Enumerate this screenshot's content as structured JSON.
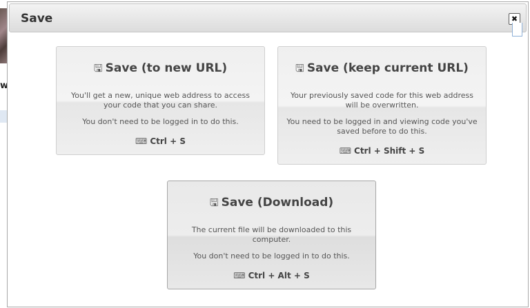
{
  "dialog": {
    "title": "Save",
    "close_label": "✖"
  },
  "background": {
    "letter": "w"
  },
  "options": [
    {
      "icon": "floppy-disk-icon",
      "title": "Save (to new URL)",
      "description": "You'll get a new, unique web address to access your code that you can share.",
      "note": "You don't need to be logged in to do this.",
      "shortcut_icon": "keyboard-icon",
      "shortcut": "Ctrl + S"
    },
    {
      "icon": "floppy-disk-icon",
      "title": "Save (keep current URL)",
      "description": "Your previously saved code for this web address will be overwritten.",
      "note": "You need to be logged in and viewing code you've saved before to do this.",
      "shortcut_icon": "keyboard-icon",
      "shortcut": "Ctrl + Shift + S"
    },
    {
      "icon": "floppy-disk-icon",
      "title": "Save (Download)",
      "description": "The current file will be downloaded to this computer.",
      "note": "You don't need to be logged in to do this.",
      "shortcut_icon": "keyboard-icon",
      "shortcut": "Ctrl + Alt + S"
    }
  ]
}
